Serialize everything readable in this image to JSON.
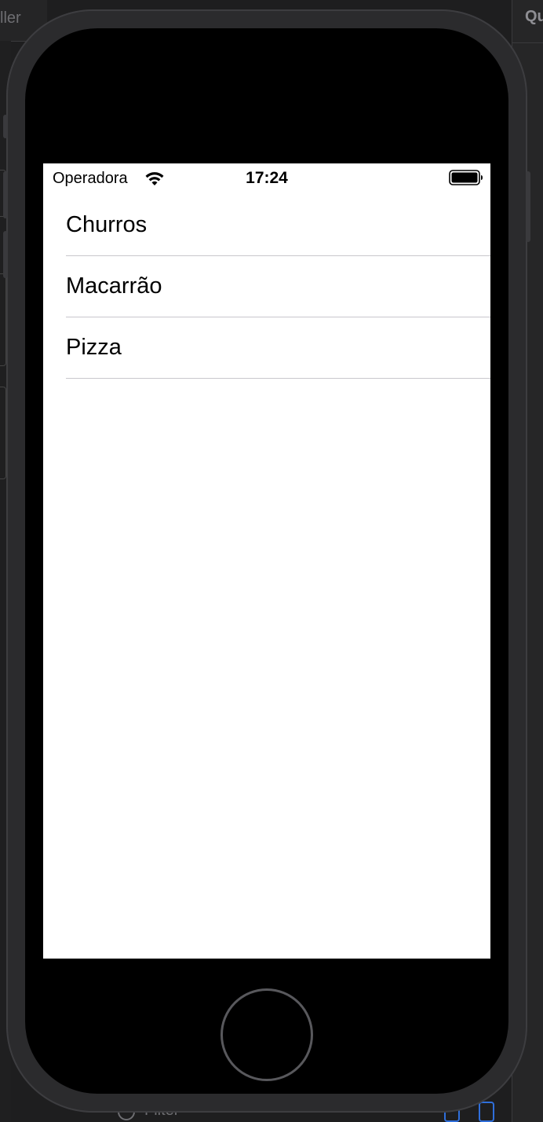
{
  "xcode": {
    "left_title_fragment": "ller",
    "right_title_fragment": "Qu",
    "filter_placeholder": "Filter"
  },
  "status_bar": {
    "carrier": "Operadora",
    "time": "17:24",
    "wifi_icon": "wifi-icon",
    "battery_icon": "battery-full-icon"
  },
  "table": {
    "rows": [
      {
        "label": "Churros"
      },
      {
        "label": "Macarrão"
      },
      {
        "label": "Pizza"
      }
    ]
  },
  "colors": {
    "screen_background": "#ffffff",
    "separator": "#c8c7cc",
    "device_frame": "#2b2b2d",
    "bezel": "#000000",
    "ide_background": "#1e1e1f"
  }
}
